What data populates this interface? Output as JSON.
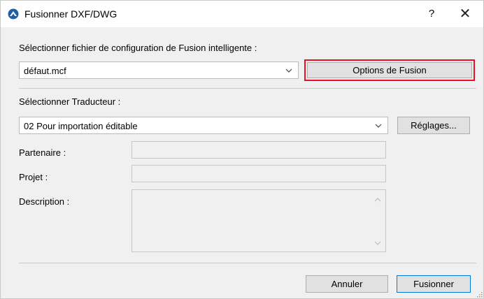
{
  "window": {
    "title": "Fusionner DXF/DWG",
    "help_label": "?",
    "close_label": "✕"
  },
  "config": {
    "label": "Sélectionner fichier de configuration de Fusion intelligente :",
    "selected": "défaut.mcf",
    "options_button": "Options de Fusion"
  },
  "translator": {
    "label": "Sélectionner Traducteur :",
    "selected": "02 Pour importation éditable",
    "settings_button": "Réglages..."
  },
  "fields": {
    "partner_label": "Partenaire :",
    "partner_value": "",
    "project_label": "Projet :",
    "project_value": "",
    "description_label": "Description :",
    "description_value": ""
  },
  "footer": {
    "cancel_button": "Annuler",
    "merge_button": "Fusionner"
  },
  "colors": {
    "highlight_border": "#e81123",
    "default_button_border": "#0078d7"
  }
}
